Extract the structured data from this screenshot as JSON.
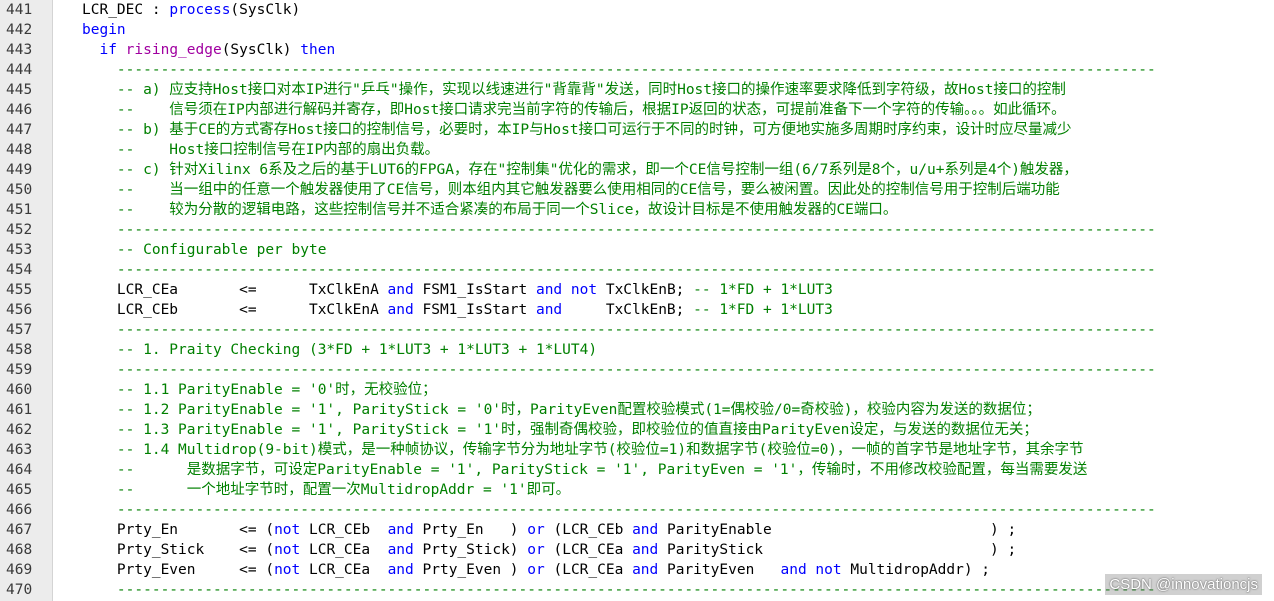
{
  "editor": {
    "watermark": "CSDN @innovationcjs",
    "separator": "-----------------------------------------------------------------------------------------------------------------------",
    "lines": [
      {
        "n": "441",
        "segs": [
          {
            "t": "LCR_DEC : "
          },
          {
            "t": "process",
            "c": "kw"
          },
          {
            "t": "(SysClk)"
          }
        ]
      },
      {
        "n": "442",
        "segs": [
          {
            "t": "begin",
            "c": "kw"
          }
        ]
      },
      {
        "n": "443",
        "segs": [
          {
            "t": "  "
          },
          {
            "t": "if",
            "c": "kw"
          },
          {
            "t": " "
          },
          {
            "t": "rising_edge",
            "c": "fn"
          },
          {
            "t": "(SysClk) "
          },
          {
            "t": "then",
            "c": "kw"
          }
        ]
      },
      {
        "n": "444",
        "segs": [
          {
            "t": "    "
          },
          {
            "t": "-----------------------------------------------------------------------------------------------------------------------",
            "c": "cm"
          }
        ]
      },
      {
        "n": "445",
        "segs": [
          {
            "t": "    "
          },
          {
            "t": "-- a) 应支持Host接口对本IP进行\"乒乓\"操作，实现以线速进行\"背靠背\"发送，同时Host接口的操作速率要求降低到字符级，故Host接口的控制",
            "c": "cm"
          }
        ]
      },
      {
        "n": "446",
        "segs": [
          {
            "t": "    "
          },
          {
            "t": "--    信号须在IP内部进行解码并寄存，即Host接口请求完当前字符的传输后，根据IP返回的状态，可提前准备下一个字符的传输。。。如此循环。",
            "c": "cm"
          }
        ]
      },
      {
        "n": "447",
        "segs": [
          {
            "t": "    "
          },
          {
            "t": "-- b) 基于CE的方式寄存Host接口的控制信号，必要时，本IP与Host接口可运行于不同的时钟，可方便地实施多周期时序约束，设计时应尽量减少",
            "c": "cm"
          }
        ]
      },
      {
        "n": "448",
        "segs": [
          {
            "t": "    "
          },
          {
            "t": "--    Host接口控制信号在IP内部的扇出负载。",
            "c": "cm"
          }
        ]
      },
      {
        "n": "449",
        "segs": [
          {
            "t": "    "
          },
          {
            "t": "-- c) 针对Xilinx 6系及之后的基于LUT6的FPGA，存在\"控制集\"优化的需求，即一个CE信号控制一组(6/7系列是8个，u/u+系列是4个)触发器，",
            "c": "cm"
          }
        ]
      },
      {
        "n": "450",
        "segs": [
          {
            "t": "    "
          },
          {
            "t": "--    当一组中的任意一个触发器使用了CE信号，则本组内其它触发器要么使用相同的CE信号，要么被闲置。因此处的控制信号用于控制后端功能",
            "c": "cm"
          }
        ]
      },
      {
        "n": "451",
        "segs": [
          {
            "t": "    "
          },
          {
            "t": "--    较为分散的逻辑电路，这些控制信号并不适合紧凑的布局于同一个Slice，故设计目标是不使用触发器的CE端口。",
            "c": "cm"
          }
        ]
      },
      {
        "n": "452",
        "segs": [
          {
            "t": "    "
          },
          {
            "t": "-----------------------------------------------------------------------------------------------------------------------",
            "c": "cm"
          }
        ]
      },
      {
        "n": "453",
        "segs": [
          {
            "t": "    "
          },
          {
            "t": "-- Configurable per byte",
            "c": "cm"
          }
        ]
      },
      {
        "n": "454",
        "segs": [
          {
            "t": "    "
          },
          {
            "t": "-----------------------------------------------------------------------------------------------------------------------",
            "c": "cm"
          }
        ]
      },
      {
        "n": "455",
        "segs": [
          {
            "t": "    LCR_CEa       <=      TxClkEnA "
          },
          {
            "t": "and",
            "c": "kw"
          },
          {
            "t": " FSM1_IsStart "
          },
          {
            "t": "and",
            "c": "kw"
          },
          {
            "t": " "
          },
          {
            "t": "not",
            "c": "kw"
          },
          {
            "t": " TxClkEnB; "
          },
          {
            "t": "-- 1*FD + 1*LUT3",
            "c": "cm"
          }
        ]
      },
      {
        "n": "456",
        "segs": [
          {
            "t": "    LCR_CEb       <=      TxClkEnA "
          },
          {
            "t": "and",
            "c": "kw"
          },
          {
            "t": " FSM1_IsStart "
          },
          {
            "t": "and",
            "c": "kw"
          },
          {
            "t": "     TxClkEnB; "
          },
          {
            "t": "-- 1*FD + 1*LUT3",
            "c": "cm"
          }
        ]
      },
      {
        "n": "457",
        "segs": [
          {
            "t": "    "
          },
          {
            "t": "-----------------------------------------------------------------------------------------------------------------------",
            "c": "cm"
          }
        ]
      },
      {
        "n": "458",
        "segs": [
          {
            "t": "    "
          },
          {
            "t": "-- 1. Praity Checking (3*FD + 1*LUT3 + 1*LUT3 + 1*LUT4)",
            "c": "cm"
          }
        ]
      },
      {
        "n": "459",
        "segs": [
          {
            "t": "    "
          },
          {
            "t": "-----------------------------------------------------------------------------------------------------------------------",
            "c": "cm"
          }
        ]
      },
      {
        "n": "460",
        "segs": [
          {
            "t": "    "
          },
          {
            "t": "-- 1.1 ParityEnable = '0'时，无校验位；",
            "c": "cm"
          }
        ]
      },
      {
        "n": "461",
        "segs": [
          {
            "t": "    "
          },
          {
            "t": "-- 1.2 ParityEnable = '1', ParityStick = '0'时，ParityEven配置校验模式(1=偶校验/0=奇校验)，校验内容为发送的数据位；",
            "c": "cm"
          }
        ]
      },
      {
        "n": "462",
        "segs": [
          {
            "t": "    "
          },
          {
            "t": "-- 1.3 ParityEnable = '1', ParityStick = '1'时，强制奇偶校验，即校验位的值直接由ParityEven设定，与发送的数据位无关；",
            "c": "cm"
          }
        ]
      },
      {
        "n": "463",
        "segs": [
          {
            "t": "    "
          },
          {
            "t": "-- 1.4 Multidrop(9-bit)模式，是一种帧协议，传输字节分为地址字节(校验位=1)和数据字节(校验位=0)，一帧的首字节是地址字节，其余字节",
            "c": "cm"
          }
        ]
      },
      {
        "n": "464",
        "segs": [
          {
            "t": "    "
          },
          {
            "t": "--      是数据字节，可设定ParityEnable = '1', ParityStick = '1', ParityEven = '1'，传输时，不用修改校验配置，每当需要发送",
            "c": "cm"
          }
        ]
      },
      {
        "n": "465",
        "segs": [
          {
            "t": "    "
          },
          {
            "t": "--      一个地址字节时，配置一次MultidropAddr = '1'即可。",
            "c": "cm"
          }
        ]
      },
      {
        "n": "466",
        "segs": [
          {
            "t": "    "
          },
          {
            "t": "-----------------------------------------------------------------------------------------------------------------------",
            "c": "cm"
          }
        ]
      },
      {
        "n": "467",
        "segs": [
          {
            "t": "    Prty_En       <= ("
          },
          {
            "t": "not",
            "c": "kw"
          },
          {
            "t": " LCR_CEb  "
          },
          {
            "t": "and",
            "c": "kw"
          },
          {
            "t": " Prty_En   ) "
          },
          {
            "t": "or",
            "c": "kw"
          },
          {
            "t": " (LCR_CEb "
          },
          {
            "t": "and",
            "c": "kw"
          },
          {
            "t": " ParityEnable                         ) ;"
          }
        ]
      },
      {
        "n": "468",
        "segs": [
          {
            "t": "    Prty_Stick    <= ("
          },
          {
            "t": "not",
            "c": "kw"
          },
          {
            "t": " LCR_CEa  "
          },
          {
            "t": "and",
            "c": "kw"
          },
          {
            "t": " Prty_Stick) "
          },
          {
            "t": "or",
            "c": "kw"
          },
          {
            "t": " (LCR_CEa "
          },
          {
            "t": "and",
            "c": "kw"
          },
          {
            "t": " ParityStick                          ) ;"
          }
        ]
      },
      {
        "n": "469",
        "segs": [
          {
            "t": "    Prty_Even     <= ("
          },
          {
            "t": "not",
            "c": "kw"
          },
          {
            "t": " LCR_CEa  "
          },
          {
            "t": "and",
            "c": "kw"
          },
          {
            "t": " Prty_Even ) "
          },
          {
            "t": "or",
            "c": "kw"
          },
          {
            "t": " (LCR_CEa "
          },
          {
            "t": "and",
            "c": "kw"
          },
          {
            "t": " ParityEven   "
          },
          {
            "t": "and",
            "c": "kw"
          },
          {
            "t": " "
          },
          {
            "t": "not",
            "c": "kw"
          },
          {
            "t": " MultidropAddr) ;"
          }
        ]
      },
      {
        "n": "470",
        "segs": [
          {
            "t": "    "
          },
          {
            "t": "-----------------------------------------------------------------------------------------------------------------------",
            "c": "cm"
          }
        ]
      }
    ]
  }
}
